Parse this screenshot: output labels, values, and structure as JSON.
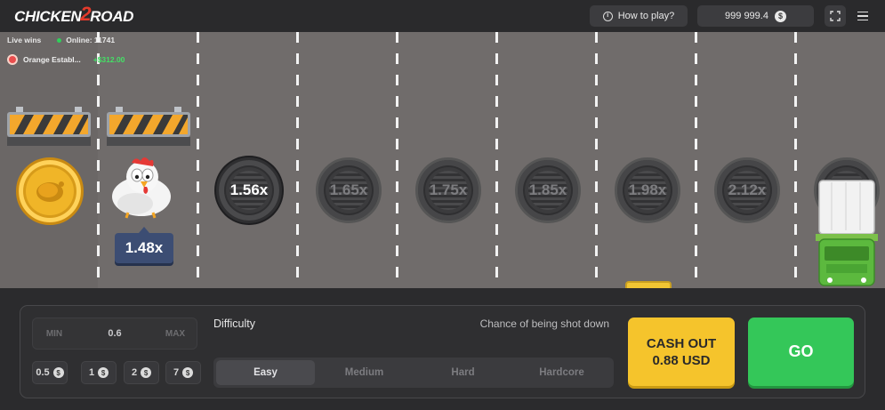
{
  "header": {
    "logo": {
      "part1": "CHICKEN",
      "num": "2",
      "part2": "ROAD"
    },
    "how_to_play": "How to play?",
    "balance": "999 999.4",
    "currency_symbol": "$"
  },
  "live": {
    "label": "Live wins",
    "online": "Online: 11741",
    "winner_name": "Orange Establ...",
    "winner_amount": "+$312.00"
  },
  "road": {
    "current_multiplier": "1.48x",
    "next_multipliers": [
      "1.56x",
      "1.65x",
      "1.75x",
      "1.85x",
      "1.98x",
      "2.12x"
    ]
  },
  "bet": {
    "min_label": "MIN",
    "value": "0.6",
    "max_label": "MAX",
    "quick_bets": [
      "0.5",
      "1",
      "2",
      "7"
    ]
  },
  "difficulty": {
    "label": "Difficulty",
    "chance_label": "Chance of being shot down",
    "options": [
      "Easy",
      "Medium",
      "Hard",
      "Hardcore"
    ],
    "selected": "Easy"
  },
  "actions": {
    "cashout_line1": "CASH OUT",
    "cashout_line2": "0.88 USD",
    "go": "GO"
  },
  "colors": {
    "accent_yellow": "#f5c42c",
    "accent_green": "#34c759",
    "road": "#706c6b",
    "win_green": "#44e066"
  }
}
